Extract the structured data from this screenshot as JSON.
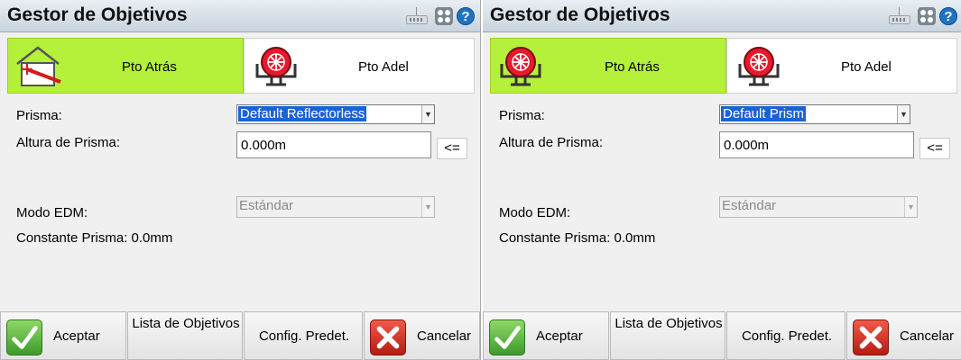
{
  "panels": [
    {
      "title": "Gestor de Objetivos",
      "tabs": {
        "back": "Pto Atrás",
        "front": "Pto Adel"
      },
      "prism_label": "Prisma:",
      "prism_value": "Default Reflectorless",
      "height_label": "Altura de Prisma:",
      "height_value": "0.000m",
      "copy_button": "<=",
      "edm_label": "Modo EDM:",
      "edm_value": "Estándar",
      "constant_text": "Constante Prisma: 0.0mm",
      "buttons": {
        "accept": "Aceptar",
        "target_list": "Lista de Objetivos",
        "defaults": "Config. Predet.",
        "cancel": "Cancelar"
      }
    },
    {
      "title": "Gestor de Objetivos",
      "tabs": {
        "back": "Pto Atrás",
        "front": "Pto Adel"
      },
      "prism_label": "Prisma:",
      "prism_value": "Default Prism",
      "height_label": "Altura de Prisma:",
      "height_value": "0.000m",
      "copy_button": "<=",
      "edm_label": "Modo EDM:",
      "edm_value": "Estándar",
      "constant_text": "Constante Prisma: 0.0mm",
      "buttons": {
        "accept": "Aceptar",
        "target_list": "Lista de Objetivos",
        "defaults": "Config. Predet.",
        "cancel": "Cancelar"
      }
    }
  ],
  "icons": {
    "keyboard": "keyboard-icon",
    "grid": "grid-icon",
    "help": "help-icon",
    "backsight_house": "house-backsight-icon",
    "prism_target": "prism-target-icon",
    "accept": "checkmark-icon",
    "cancel": "x-icon"
  },
  "colors": {
    "active_tab": "#b5f03a",
    "selection": "#1a63d6",
    "help_icon": "#1f73c2",
    "target_red": "#e8192c",
    "accept_green": "#3d9b2a",
    "cancel_red": "#c8261a"
  }
}
